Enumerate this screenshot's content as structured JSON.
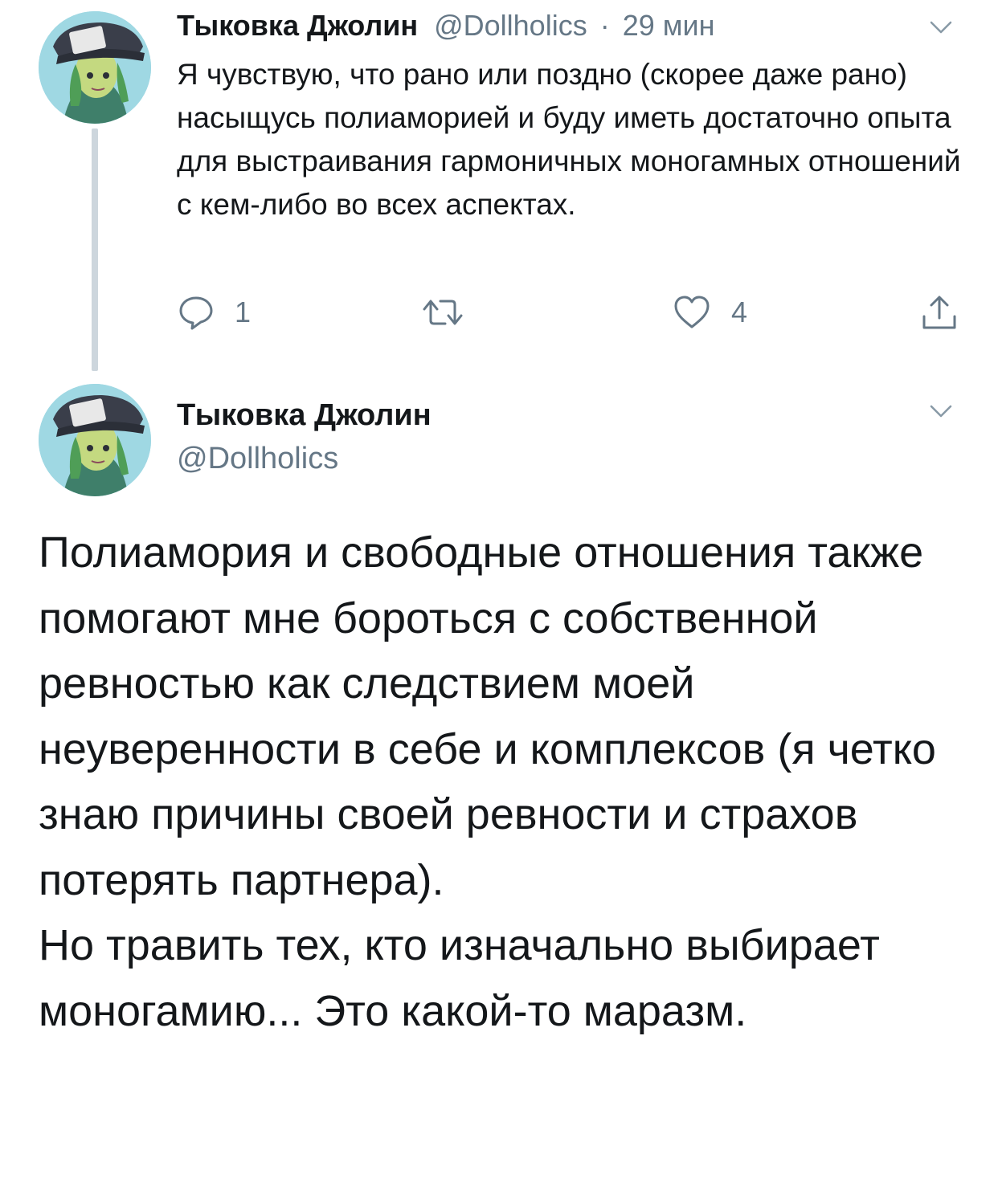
{
  "tweet1": {
    "author_name": "Тыковка Джолин",
    "handle": "@Dollholics",
    "separator": "·",
    "time": "29 мин",
    "text": "Я чувствую, что рано или поздно (скорее даже рано) насыщусь полиаморией и буду иметь достаточно опыта для выстраивания гармоничных моногамных отношений с кем-либо во всех аспектах.",
    "reply_count": "1",
    "retweet_count": "",
    "like_count": "4",
    "icons": [
      "reply-icon",
      "retweet-icon",
      "like-icon",
      "share-icon",
      "chevron-down-icon"
    ]
  },
  "tweet2": {
    "author_name": "Тыковка Джолин",
    "handle": "@Dollholics",
    "text_paragraph_1": "Полиамория и свободные отношения также помогают мне бороться с собственной ревностью как следствием моей неуверенности в себе и комплексов (я четко знаю причины своей ревности и страхов потерять партнера).",
    "text_paragraph_2": "Но травить тех, кто изначально выбирает моногамию... Это какой-то маразм.",
    "icons": [
      "chevron-down-icon"
    ]
  },
  "colors": {
    "text_primary": "#14171a",
    "text_muted": "#657786",
    "thread_line": "#cdd6dd",
    "avatar_bg": "#9fd8e3"
  }
}
